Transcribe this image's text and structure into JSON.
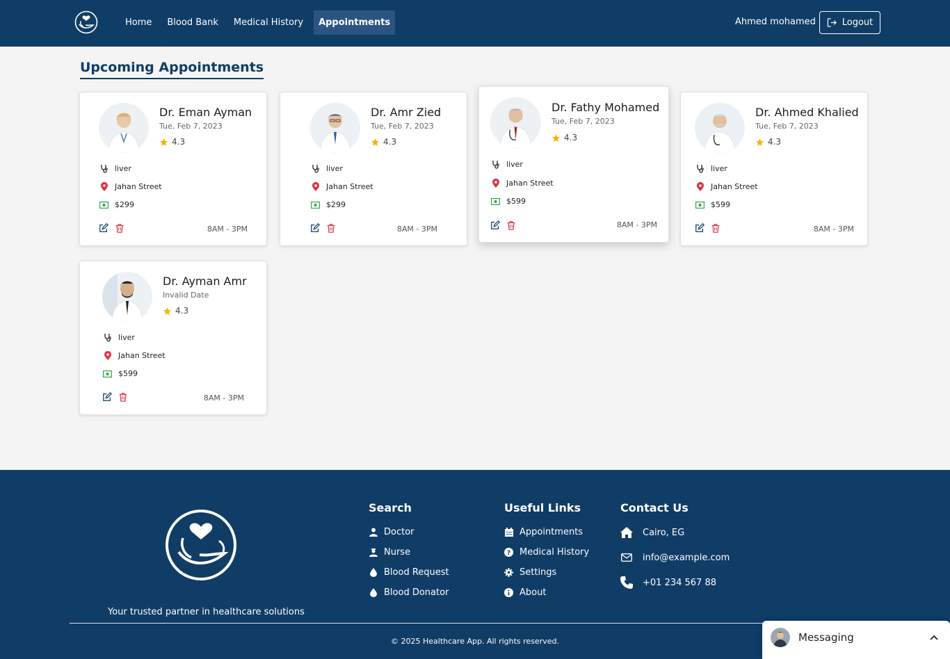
{
  "nav": {
    "links": [
      {
        "label": "Home"
      },
      {
        "label": "Blood Bank"
      },
      {
        "label": "Medical History"
      },
      {
        "label": "Appointments"
      }
    ],
    "active_index": 3,
    "user_name": "Ahmed mohamed",
    "logout_label": "Logout"
  },
  "page": {
    "title": "Upcoming Appointments"
  },
  "appointments": [
    {
      "name": "Dr. Eman Ayman",
      "date": "Tue, Feb 7, 2023",
      "rating": "4.3",
      "specialty": "liver",
      "location": "Jahan Street",
      "price": "$299",
      "hours": "8AM - 3PM"
    },
    {
      "name": "Dr. Amr Zied",
      "date": "Tue, Feb 7, 2023",
      "rating": "4.3",
      "specialty": "liver",
      "location": "Jahan Street",
      "price": "$299",
      "hours": "8AM - 3PM"
    },
    {
      "name": "Dr. Fathy Mohamed",
      "date": "Tue, Feb 7, 2023",
      "rating": "4.3",
      "specialty": "liver",
      "location": "Jahan Street",
      "price": "$599",
      "hours": "8AM - 3PM"
    },
    {
      "name": "Dr. Ahmed Khalied",
      "date": "Tue, Feb 7, 2023",
      "rating": "4.3",
      "specialty": "liver",
      "location": "Jahan Street",
      "price": "$599",
      "hours": "8AM - 3PM"
    },
    {
      "name": "Dr. Ayman Amr",
      "date": "Invalid Date",
      "rating": "4.3",
      "specialty": "liver",
      "location": "Jahan Street",
      "price": "$599",
      "hours": "8AM - 3PM"
    }
  ],
  "footer": {
    "tagline": "Your trusted partner in healthcare solutions",
    "search": {
      "title": "Search",
      "links": [
        {
          "label": "Doctor",
          "icon": "user-doctor-icon"
        },
        {
          "label": "Nurse",
          "icon": "user-nurse-icon"
        },
        {
          "label": "Blood Request",
          "icon": "droplet-icon"
        },
        {
          "label": "Blood Donator",
          "icon": "droplet-icon"
        }
      ]
    },
    "useful": {
      "title": "Useful Links",
      "links": [
        {
          "label": "Appointments",
          "icon": "calendar-icon"
        },
        {
          "label": "Medical History",
          "icon": "question-circle-icon"
        },
        {
          "label": "Settings",
          "icon": "gear-icon"
        },
        {
          "label": "About",
          "icon": "info-circle-icon"
        }
      ]
    },
    "contact": {
      "title": "Contact Us",
      "items": [
        {
          "label": "Cairo, EG",
          "icon": "home-icon"
        },
        {
          "label": "info@example.com",
          "icon": "envelope-icon"
        },
        {
          "label": "+01 234 567 88",
          "icon": "phone-icon"
        }
      ]
    },
    "copyright": "© 2025 Healthcare App. All rights reserved."
  },
  "messaging": {
    "label": "Messaging"
  },
  "colors": {
    "primary": "#0f3d66",
    "nav_active": "#2b5580",
    "star": "#f5b301",
    "location": "#dc3545",
    "money": "#28a745",
    "delete": "#dc3545"
  }
}
